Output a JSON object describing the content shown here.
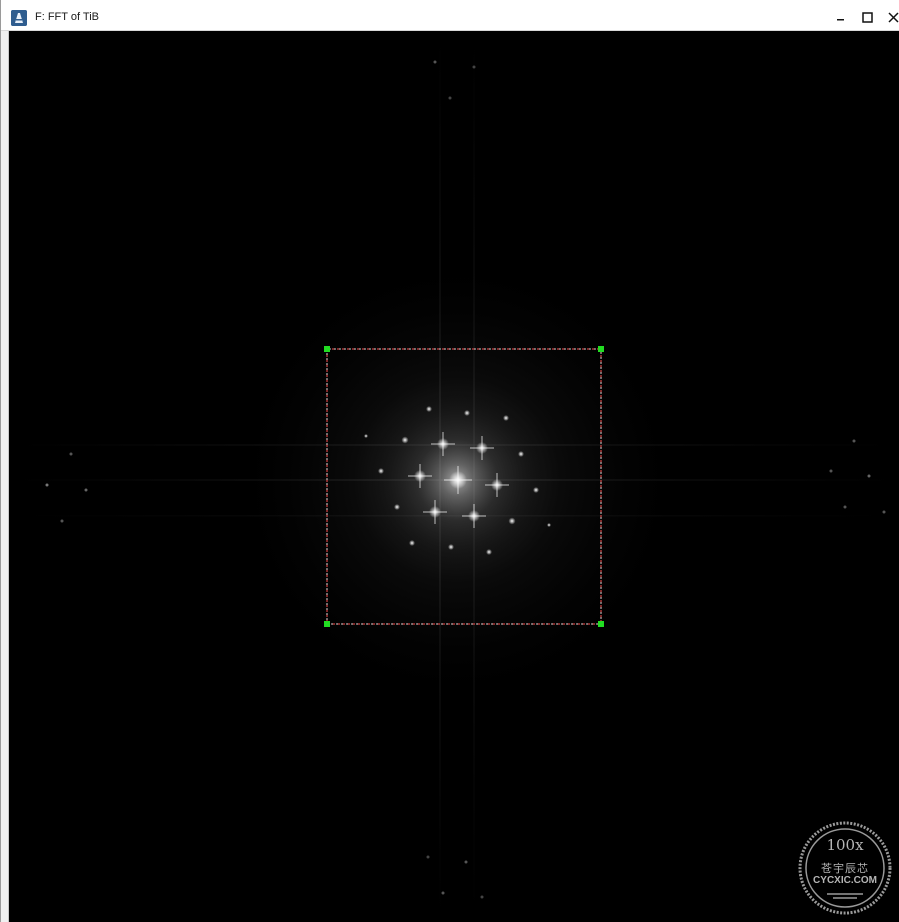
{
  "window": {
    "title": "F: FFT of TiB"
  },
  "controls": {
    "minimize": "minimize",
    "maximize": "maximize",
    "close": "close"
  },
  "image": {
    "description_icon": "fft-image",
    "roi_shape": "rectangle",
    "roi_border_color": "#ff5050",
    "roi_handle_color": "#22dd22"
  },
  "watermark": {
    "zoom": "100x",
    "cn_text": "苍宇辰芯",
    "url": "CYCXIC.COM"
  },
  "colors": {
    "background": "#000000",
    "spot": "#ffffff",
    "titlebar": "#ffffff"
  }
}
